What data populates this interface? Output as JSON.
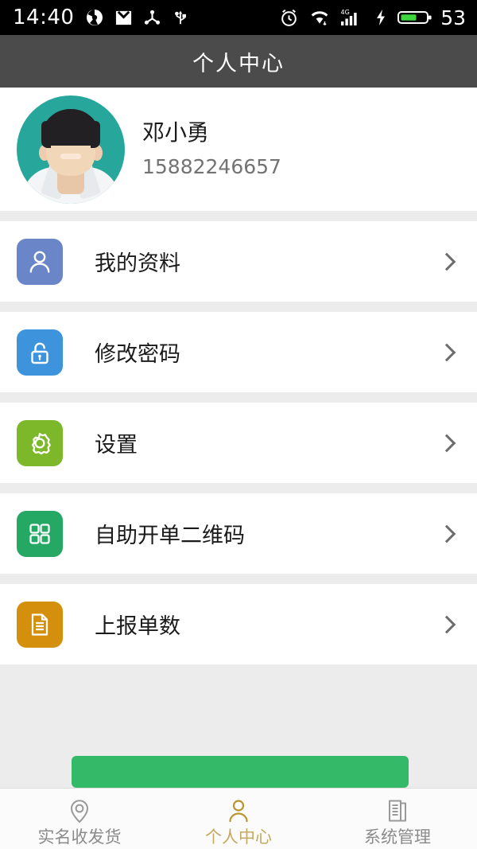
{
  "status_bar": {
    "time": "14:40",
    "battery_percent": "53",
    "network": "4G",
    "left_icons": [
      "camera-shutter-icon",
      "mail-icon",
      "share-icon",
      "usb-icon"
    ],
    "right_icons": [
      "alarm-clock-icon",
      "wifi-icon",
      "signal-bars-icon",
      "charging-bolt-icon",
      "battery-icon"
    ]
  },
  "header": {
    "title": "个人中心"
  },
  "profile": {
    "name": "邓小勇",
    "phone": "15882246657",
    "avatar_bg": "#27a79b"
  },
  "menu": {
    "items": [
      {
        "label": "我的资料",
        "icon": "person-icon",
        "icon_bg": "#6b85c9",
        "chevron": "chevron-right-icon"
      },
      {
        "label": "修改密码",
        "icon": "lock-icon",
        "icon_bg": "#3e93dd",
        "chevron": "chevron-right-icon"
      },
      {
        "label": "设置",
        "icon": "gear-icon",
        "icon_bg": "#7cb829",
        "chevron": "chevron-right-icon"
      },
      {
        "label": "自助开单二维码",
        "icon": "grid-icon",
        "icon_bg": "#24a863",
        "chevron": "chevron-right-icon"
      },
      {
        "label": "上报单数",
        "icon": "document-icon",
        "icon_bg": "#d4900c",
        "chevron": "chevron-right-icon"
      }
    ]
  },
  "logout_button": {
    "color": "#33b968"
  },
  "tabbar": {
    "active_color": "#c6a961",
    "inactive_color": "#8b8b8b",
    "tabs": [
      {
        "label": "实名收发货",
        "icon": "location-pin-icon",
        "active": false
      },
      {
        "label": "个人中心",
        "icon": "person-icon",
        "active": true
      },
      {
        "label": "系统管理",
        "icon": "documents-icon",
        "active": false
      }
    ]
  }
}
